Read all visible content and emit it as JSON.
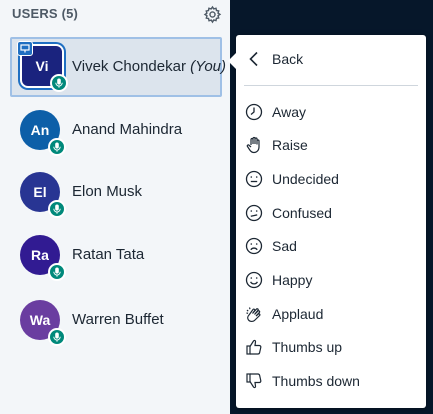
{
  "users_panel": {
    "title": "USERS (5)",
    "users": [
      {
        "initials": "Vi",
        "name": "Vivek Chondekar",
        "you_label": "(You)",
        "color": "#1a237e",
        "selected": true,
        "presenter": true
      },
      {
        "initials": "An",
        "name": "Anand Mahindra",
        "color": "#0d5fa8"
      },
      {
        "initials": "El",
        "name": "Elon Musk",
        "color": "#283593"
      },
      {
        "initials": "Ra",
        "name": "Ratan Tata",
        "color": "#311b92"
      },
      {
        "initials": "Wa",
        "name": "Warren Buffet",
        "color": "#6a3da0"
      }
    ]
  },
  "status_menu": {
    "back_label": "Back",
    "items": [
      {
        "label": "Away",
        "icon": "clock-icon"
      },
      {
        "label": "Raise",
        "icon": "hand-icon"
      },
      {
        "label": "Undecided",
        "icon": "neutral-face-icon"
      },
      {
        "label": "Confused",
        "icon": "confused-face-icon"
      },
      {
        "label": "Sad",
        "icon": "sad-face-icon"
      },
      {
        "label": "Happy",
        "icon": "happy-face-icon"
      },
      {
        "label": "Applaud",
        "icon": "applaud-icon"
      },
      {
        "label": "Thumbs up",
        "icon": "thumbs-up-icon"
      },
      {
        "label": "Thumbs down",
        "icon": "thumbs-down-icon"
      }
    ]
  },
  "colors": {
    "mic_badge": "#00897b",
    "presenter_badge": "#1f6fc2",
    "panel_bg": "#f3f6f9",
    "page_bg": "#06172a"
  }
}
